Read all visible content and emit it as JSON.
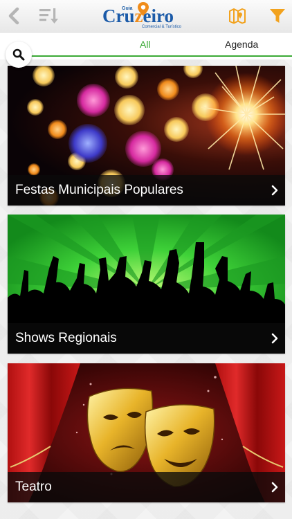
{
  "header": {
    "back_icon": "chevron-left-icon",
    "sort_icon": "sort-list-icon",
    "logo": {
      "small_text": "Guia",
      "main_text_prefix": "Cru",
      "main_text_accent": "z",
      "main_text_suffix": "eiro",
      "subtitle": "Comercial & Turístico"
    },
    "map_icon": "map-icon",
    "filter_icon": "funnel-icon",
    "accent_color": "#f2a21d"
  },
  "tabs": {
    "all_label": "All",
    "agenda_label": "Agenda",
    "active_color": "#3aa935"
  },
  "search": {
    "icon": "search-icon"
  },
  "cards": [
    {
      "title": "Festas Municipais Populares",
      "image": "festival-bokeh-fireworks"
    },
    {
      "title": "Shows Regionais",
      "image": "crowd-silhouette-green"
    },
    {
      "title": "Teatro",
      "image": "theater-masks-curtains"
    }
  ]
}
